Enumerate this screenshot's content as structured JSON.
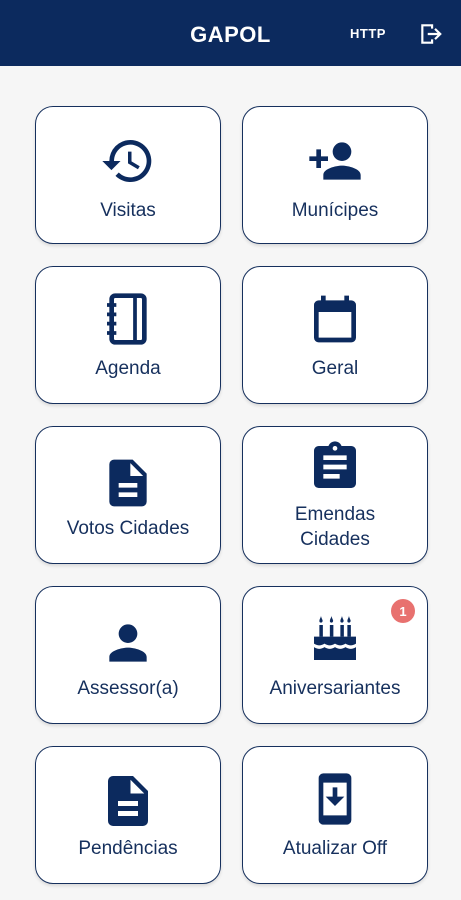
{
  "app": {
    "title": "GAPOL",
    "http_label": "HTTP",
    "logout_icon": "logout-icon"
  },
  "colors": {
    "primary": "#0c2a5e",
    "badge": "#e8716f",
    "tile_border": "#16305d"
  },
  "tiles": [
    {
      "label": "Visitas",
      "icon": "history-icon"
    },
    {
      "label": "Munícipes",
      "icon": "add-person-icon"
    },
    {
      "label": "Agenda",
      "icon": "notebook-icon"
    },
    {
      "label": "Geral",
      "icon": "calendar-icon"
    },
    {
      "label": "Votos Cidades",
      "icon": "document-icon"
    },
    {
      "label_line1": "Emendas",
      "label_line2": "Cidades",
      "icon": "clipboard-icon"
    },
    {
      "label": "Assessor(a)",
      "icon": "person-icon"
    },
    {
      "label": "Aniversariantes",
      "icon": "birthday-cake-icon",
      "badge": "1"
    },
    {
      "label": "Pendências",
      "icon": "document-lines-icon"
    },
    {
      "label": "Atualizar Off",
      "icon": "phone-download-icon"
    }
  ]
}
